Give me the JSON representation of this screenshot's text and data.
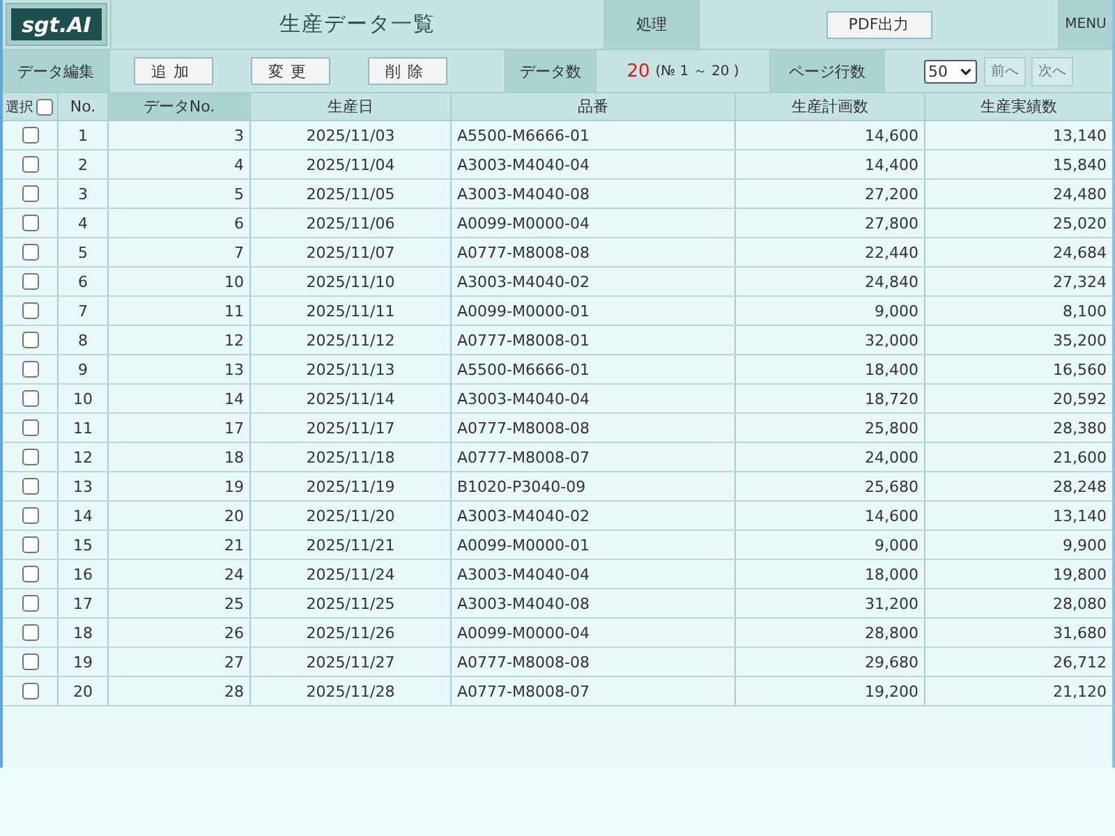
{
  "header": {
    "logo": "sgt.AI",
    "title": "生産データ一覧",
    "process_label": "処理",
    "pdf_button": "PDF出力",
    "menu": "MENU"
  },
  "toolbar": {
    "edit_label": "データ編集",
    "edit_buttons": [
      "追加",
      "変更",
      "削除"
    ],
    "count_label": "データ数",
    "count": "20",
    "range": "(№ 1 ～ 20 )",
    "page_rows_label": "ページ行数",
    "page_rows": "50",
    "pager": [
      {
        "label": "前へ",
        "disabled": true
      },
      {
        "label": "次へ",
        "disabled": true
      }
    ]
  },
  "table": {
    "select_all": {
      "label": "選択",
      "checked": false
    },
    "columns": [
      {
        "label": "No.",
        "sorted": false
      },
      {
        "label": "データNo.",
        "sorted": true
      },
      {
        "label": "生産日",
        "sorted": false
      },
      {
        "label": "品番",
        "sorted": false
      },
      {
        "label": "生産計画数",
        "sorted": false
      },
      {
        "label": "生産実績数",
        "sorted": false
      }
    ],
    "rows": [
      {
        "checked": false,
        "cells": [
          "1",
          "3",
          "2025/11/03",
          "A5500-M6666-01",
          "14,600",
          "13,140"
        ]
      },
      {
        "checked": false,
        "cells": [
          "2",
          "4",
          "2025/11/04",
          "A3003-M4040-04",
          "14,400",
          "15,840"
        ]
      },
      {
        "checked": false,
        "cells": [
          "3",
          "5",
          "2025/11/05",
          "A3003-M4040-08",
          "27,200",
          "24,480"
        ]
      },
      {
        "checked": false,
        "cells": [
          "4",
          "6",
          "2025/11/06",
          "A0099-M0000-04",
          "27,800",
          "25,020"
        ]
      },
      {
        "checked": false,
        "cells": [
          "5",
          "7",
          "2025/11/07",
          "A0777-M8008-08",
          "22,440",
          "24,684"
        ]
      },
      {
        "checked": false,
        "cells": [
          "6",
          "10",
          "2025/11/10",
          "A3003-M4040-02",
          "24,840",
          "27,324"
        ]
      },
      {
        "checked": false,
        "cells": [
          "7",
          "11",
          "2025/11/11",
          "A0099-M0000-01",
          "9,000",
          "8,100"
        ]
      },
      {
        "checked": false,
        "cells": [
          "8",
          "12",
          "2025/11/12",
          "A0777-M8008-01",
          "32,000",
          "35,200"
        ]
      },
      {
        "checked": false,
        "cells": [
          "9",
          "13",
          "2025/11/13",
          "A5500-M6666-01",
          "18,400",
          "16,560"
        ]
      },
      {
        "checked": false,
        "cells": [
          "10",
          "14",
          "2025/11/14",
          "A3003-M4040-04",
          "18,720",
          "20,592"
        ]
      },
      {
        "checked": false,
        "cells": [
          "11",
          "17",
          "2025/11/17",
          "A0777-M8008-08",
          "25,800",
          "28,380"
        ]
      },
      {
        "checked": false,
        "cells": [
          "12",
          "18",
          "2025/11/18",
          "A0777-M8008-07",
          "24,000",
          "21,600"
        ]
      },
      {
        "checked": false,
        "cells": [
          "13",
          "19",
          "2025/11/19",
          "B1020-P3040-09",
          "25,680",
          "28,248"
        ]
      },
      {
        "checked": false,
        "cells": [
          "14",
          "20",
          "2025/11/20",
          "A3003-M4040-02",
          "14,600",
          "13,140"
        ]
      },
      {
        "checked": false,
        "cells": [
          "15",
          "21",
          "2025/11/21",
          "A0099-M0000-01",
          "9,000",
          "9,900"
        ]
      },
      {
        "checked": false,
        "cells": [
          "16",
          "24",
          "2025/11/24",
          "A3003-M4040-04",
          "18,000",
          "19,800"
        ]
      },
      {
        "checked": false,
        "cells": [
          "17",
          "25",
          "2025/11/25",
          "A3003-M4040-08",
          "31,200",
          "28,080"
        ]
      },
      {
        "checked": false,
        "cells": [
          "18",
          "26",
          "2025/11/26",
          "A0099-M0000-04",
          "28,800",
          "31,680"
        ]
      },
      {
        "checked": false,
        "cells": [
          "19",
          "27",
          "2025/11/27",
          "A0777-M8008-08",
          "29,680",
          "26,712"
        ]
      },
      {
        "checked": false,
        "cells": [
          "20",
          "28",
          "2025/11/28",
          "A0777-M8008-07",
          "19,200",
          "21,120"
        ]
      }
    ]
  }
}
